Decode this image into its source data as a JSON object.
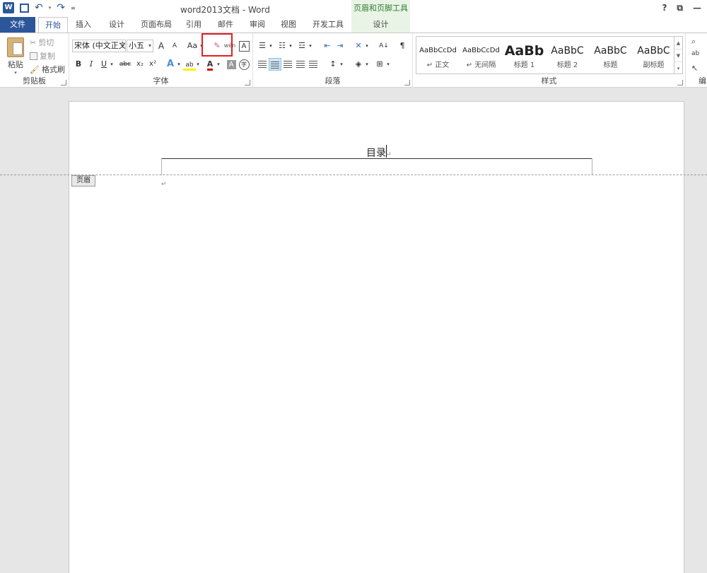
{
  "app": {
    "title": "word2013文档 - Word",
    "context_header": "页眉和页脚工具"
  },
  "window": {
    "help": "?",
    "restore": "⧉",
    "minimize": "—"
  },
  "tabs": [
    {
      "label": "文件"
    },
    {
      "label": "开始"
    },
    {
      "label": "插入"
    },
    {
      "label": "设计"
    },
    {
      "label": "页面布局"
    },
    {
      "label": "引用"
    },
    {
      "label": "邮件"
    },
    {
      "label": "审阅"
    },
    {
      "label": "视图"
    },
    {
      "label": "开发工具"
    },
    {
      "label": "设计"
    }
  ],
  "clipboard": {
    "paste": "粘贴",
    "cut": "剪切",
    "copy": "复制",
    "format_painter": "格式刷",
    "group": "剪贴板"
  },
  "font": {
    "name": "宋体 (中文正文)",
    "size": "小五",
    "grow": "A",
    "shrink": "A",
    "case": "Aa",
    "bold": "B",
    "italic": "I",
    "underline": "U",
    "strike": "abc",
    "sub": "x₂",
    "sup": "x²",
    "group": "字体"
  },
  "paragraph": {
    "group": "段落"
  },
  "styles": {
    "group": "样式",
    "items": [
      {
        "sample": "AaBbCcDd",
        "name": "↵ 正文"
      },
      {
        "sample": "AaBbCcDd",
        "name": "↵ 无间隔"
      },
      {
        "sample": "AaBb",
        "name": "标题 1"
      },
      {
        "sample": "AaBbC",
        "name": "标题 2"
      },
      {
        "sample": "AaBbC",
        "name": "标题"
      },
      {
        "sample": "AaBbC",
        "name": "副标题"
      }
    ]
  },
  "editing": {
    "group": "编"
  },
  "document": {
    "header_text": "目录",
    "header_tag": "页眉",
    "para_mark": "↵"
  }
}
